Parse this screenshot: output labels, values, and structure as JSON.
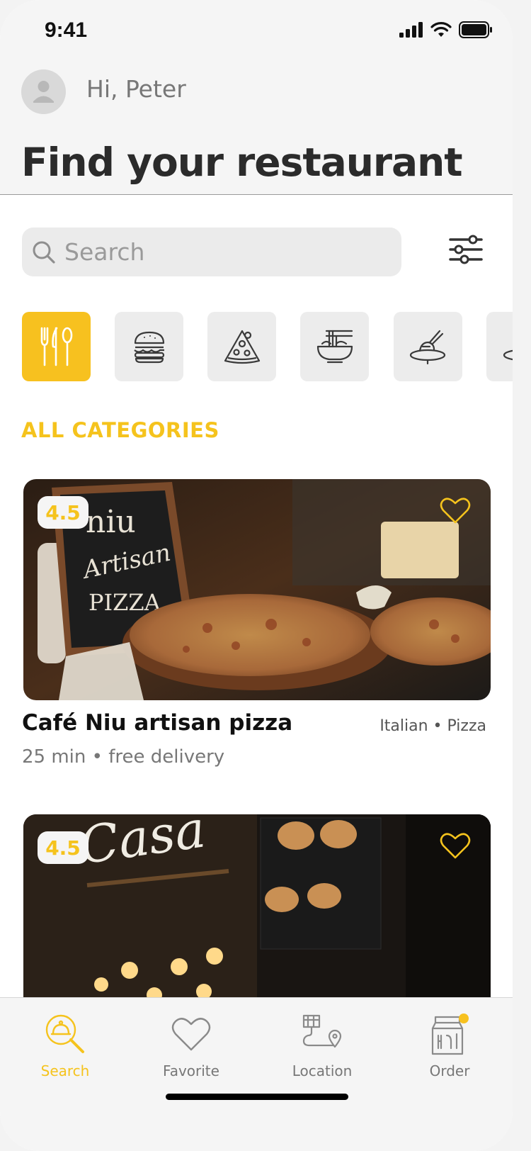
{
  "status_bar": {
    "time": "9:41"
  },
  "header": {
    "greeting": "Hi, Peter",
    "title": "Find your restaurant"
  },
  "search": {
    "placeholder": "Search"
  },
  "categories": {
    "section_label": "ALL CATEGORIES",
    "items": [
      "all-food-icon",
      "burger-icon",
      "pizza-icon",
      "noodles-icon",
      "grill-icon",
      "more-icon"
    ],
    "active_index": 0
  },
  "restaurants": [
    {
      "rating": "4.5",
      "name": "Café Niu artisan pizza",
      "tags": "Italian • Pizza",
      "meta": "25 min • free delivery",
      "image_sign": [
        "niu",
        "Artisan",
        "PIZZA"
      ]
    },
    {
      "rating": "4.5",
      "image_sign": [
        "Casa"
      ]
    }
  ],
  "tabs": [
    {
      "label": "Search",
      "icon": "search-cloche-icon"
    },
    {
      "label": "Favorite",
      "icon": "heart-icon"
    },
    {
      "label": "Location",
      "icon": "location-icon"
    },
    {
      "label": "Order",
      "icon": "order-bag-icon"
    }
  ],
  "colors": {
    "accent": "#f7c11f",
    "accent_text": "#f5c31d",
    "title": "#2b2b2b",
    "muted": "#777777",
    "chip_bg": "#ececec"
  }
}
